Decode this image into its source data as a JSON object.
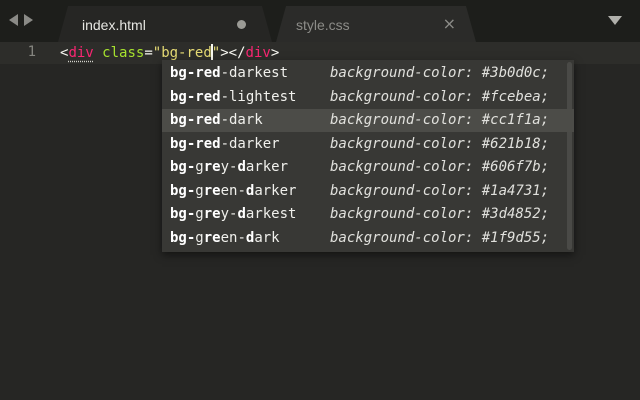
{
  "tabs": [
    {
      "label": "index.html",
      "active": true,
      "dirty": true
    },
    {
      "label": "style.css",
      "active": false,
      "close_glyph": "×"
    }
  ],
  "icons": {
    "back": "chevron-left-icon",
    "forward": "chevron-right-icon",
    "tab_menu": "triangle-down-icon",
    "dirty": "dirty-dot-icon",
    "close": "close-icon"
  },
  "editor": {
    "line_number": "1",
    "code": {
      "open_bracket": "<",
      "tag": "div",
      "space": " ",
      "attr": "class",
      "equals": "=",
      "quote_open": "\"",
      "value_before_caret": "bg-red",
      "quote_close": "\"",
      "close_bracket": ">",
      "end_tag_open": "</",
      "end_tag": "div",
      "end_tag_close": ">"
    }
  },
  "autocomplete": {
    "selected_index": 2,
    "items": [
      {
        "match": "bg-red",
        "rest": "-darkest",
        "detail": "background-color: #3b0d0c;"
      },
      {
        "match": "bg-red",
        "rest": "-lightest",
        "detail": "background-color: #fcebea;"
      },
      {
        "match": "bg-red",
        "rest": "-dark",
        "detail": "background-color: #cc1f1a;"
      },
      {
        "match": "bg-red",
        "rest": "-darker",
        "detail": "background-color: #621b18;"
      },
      {
        "segments": [
          [
            "b",
            "bg-"
          ],
          [
            "n",
            "g"
          ],
          [
            "b",
            "re"
          ],
          [
            "n",
            "y-"
          ],
          [
            "b",
            "d"
          ],
          [
            "n",
            "arker"
          ]
        ],
        "detail": "background-color: #606f7b;"
      },
      {
        "segments": [
          [
            "b",
            "bg-"
          ],
          [
            "n",
            "g"
          ],
          [
            "b",
            "re"
          ],
          [
            "n",
            "en-"
          ],
          [
            "b",
            "d"
          ],
          [
            "n",
            "arker"
          ]
        ],
        "detail": "background-color: #1a4731;"
      },
      {
        "segments": [
          [
            "b",
            "bg-"
          ],
          [
            "n",
            "g"
          ],
          [
            "b",
            "re"
          ],
          [
            "n",
            "y-"
          ],
          [
            "b",
            "d"
          ],
          [
            "n",
            "arkest"
          ]
        ],
        "detail": "background-color: #3d4852;"
      },
      {
        "segments": [
          [
            "b",
            "bg-"
          ],
          [
            "n",
            "g"
          ],
          [
            "b",
            "re"
          ],
          [
            "n",
            "en-"
          ],
          [
            "b",
            "d"
          ],
          [
            "n",
            "ark"
          ]
        ],
        "detail": "background-color: #1f9d55;"
      }
    ]
  },
  "colors": {
    "tag": "#f92672",
    "attr": "#a6e22e",
    "string": "#e6db74",
    "background": "#262624"
  }
}
